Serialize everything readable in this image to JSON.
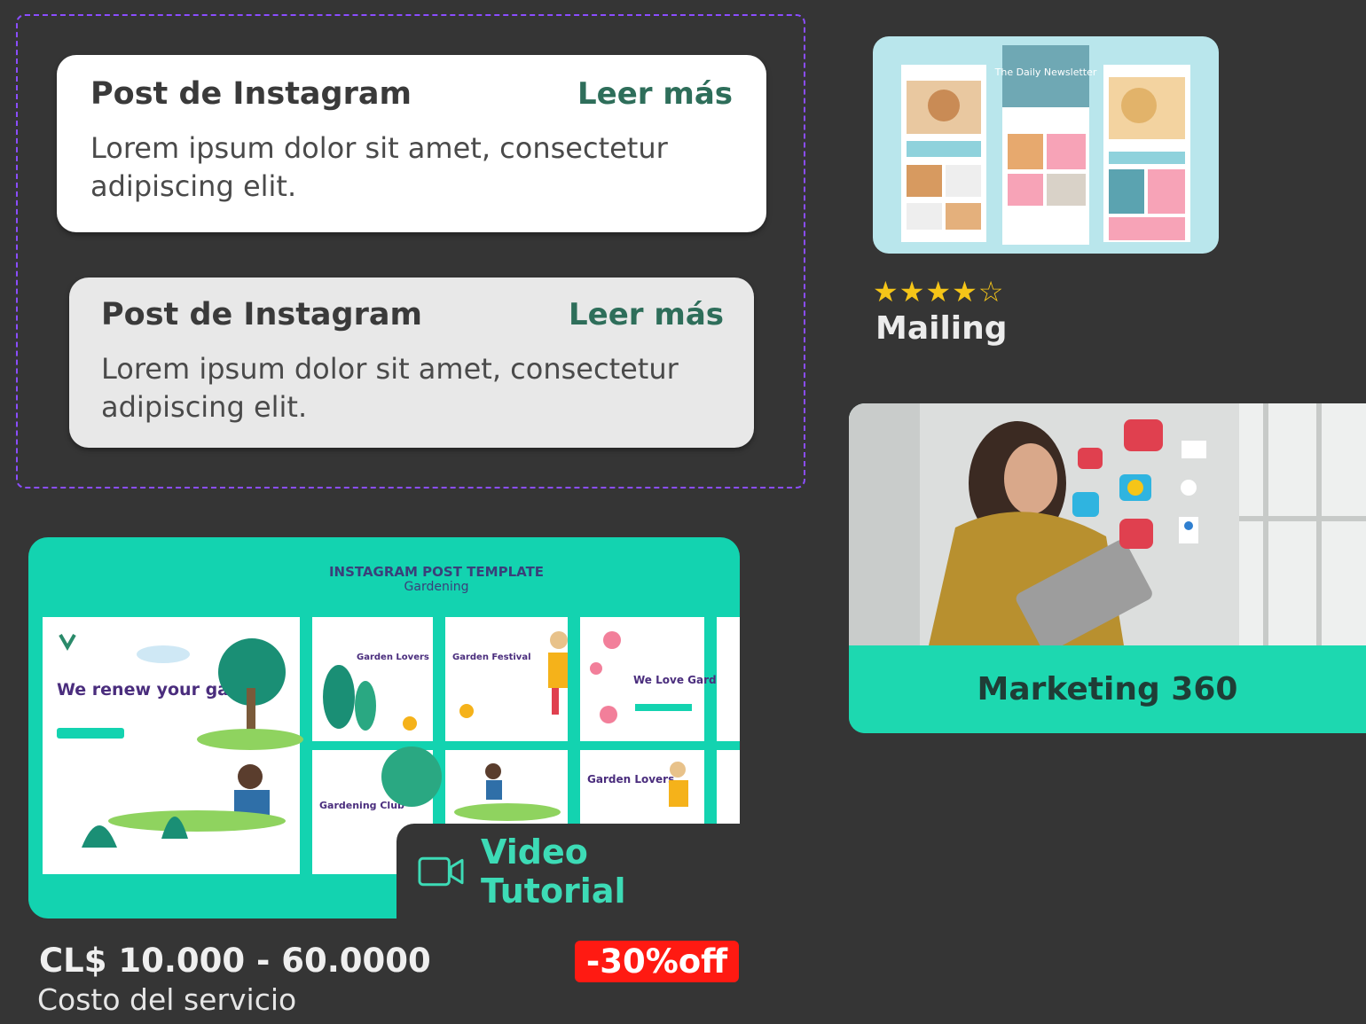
{
  "posts": [
    {
      "title": "Post de Instagram",
      "link": "Leer más",
      "body": "Lorem ipsum dolor sit amet, consectetur adipiscing elit."
    },
    {
      "title": "Post de Instagram",
      "link": "Leer más",
      "body": "Lorem ipsum dolor sit amet, consectetur adipiscing elit."
    }
  ],
  "mailing": {
    "label": "Mailing",
    "rating": 4,
    "rating_max": 5,
    "stars_text": "★★★★☆",
    "thumb_text": "The Daily Newsletter"
  },
  "marketing": {
    "label": "Marketing 360"
  },
  "instagram_template": {
    "title": "INSTAGRAM POST TEMPLATE",
    "subtitle": "Gardening",
    "tiles": [
      "We renew your garden",
      "Garden Lovers",
      "Garden Festival",
      "We Love Gardening",
      "Gardening Club",
      "Garden Lovers"
    ],
    "video_label": "Video Tutorial",
    "price": "CL$ 10.000 - 60.0000",
    "price_caption": "Costo del servicio",
    "discount": "-30%off"
  },
  "colors": {
    "background": "#353535",
    "teal": "#13d3b0",
    "link_green": "#2e6e5a",
    "discount_red": "#ff1a12",
    "frame_purple": "#8b4dff",
    "star_yellow": "#f5c518"
  }
}
